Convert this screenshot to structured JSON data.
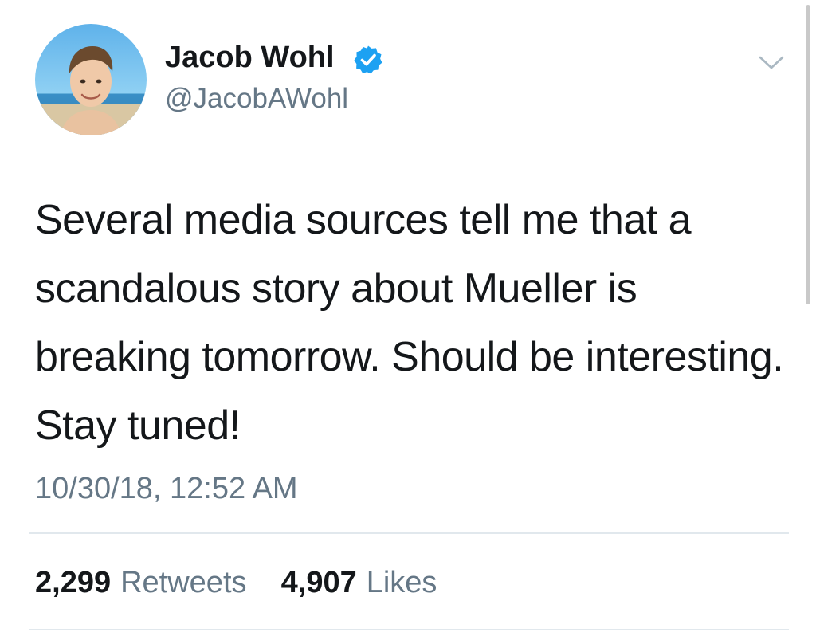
{
  "author": {
    "display_name": "Jacob Wohl",
    "handle": "@JacobAWohl",
    "verified": true
  },
  "tweet": {
    "text": "Several media sources tell me that a scandalous story about Mueller is breaking tomorrow. Should be interesting. Stay tuned!",
    "timestamp": "10/30/18, 12:52 AM"
  },
  "stats": {
    "retweets_count": "2,299",
    "retweets_label": "Retweets",
    "likes_count": "4,907",
    "likes_label": "Likes"
  },
  "icons": {
    "verified": "verified-badge-icon",
    "menu": "chevron-down-icon"
  },
  "colors": {
    "text": "#14171a",
    "secondary_text": "#657786",
    "verified_blue": "#1da1f2",
    "divider": "#e1e8ed"
  }
}
